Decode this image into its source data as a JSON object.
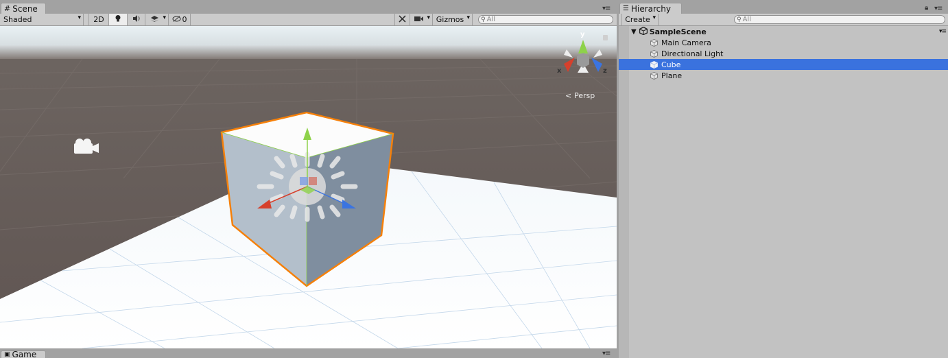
{
  "scene_panel": {
    "tab_label": "Scene",
    "shading_mode": "Shaded",
    "mode_2d": "2D",
    "hidden_count": "0",
    "gizmos_label": "Gizmos",
    "search_placeholder": "All",
    "projection_label": "Persp",
    "axis_labels": {
      "x": "x",
      "y": "y",
      "z": "z"
    }
  },
  "hierarchy_panel": {
    "tab_label": "Hierarchy",
    "create_label": "Create",
    "search_placeholder": "All",
    "scene_name": "SampleScene",
    "items": [
      {
        "label": "Main Camera",
        "selected": false
      },
      {
        "label": "Directional Light",
        "selected": false
      },
      {
        "label": "Cube",
        "selected": true
      },
      {
        "label": "Plane",
        "selected": false
      }
    ]
  },
  "game_tab": {
    "label": "Game"
  },
  "colors": {
    "selection_blue": "#3a72de",
    "selection_outline": "#f5800a",
    "x_axis": "#d6402c",
    "y_axis": "#8ed24a",
    "z_axis": "#3b74e0"
  }
}
